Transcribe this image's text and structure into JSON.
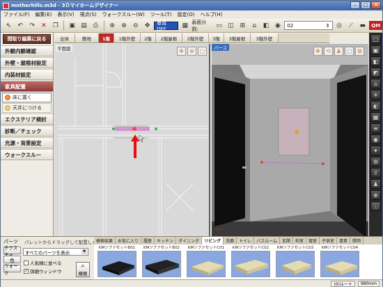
{
  "window": {
    "title": "motherhills.m3d - 3Ｄマイホームデザイナー"
  },
  "menu": [
    "ファイル(F)",
    "編集(E)",
    "表示(V)",
    "視点(S)",
    "ウォークスルー(W)",
    "ツール(T)",
    "設定(O)",
    "ヘルプ(H)"
  ],
  "toolbar": {
    "ortho_label": "垂直OFF",
    "grid_label": "画面分割:",
    "view_select": "02",
    "qm_label": "QM"
  },
  "left_panel": {
    "back_label": "間取り編集に戻る",
    "items": [
      "外観内観確認",
      "外壁・屋根材設定",
      "内装材設定",
      "家具配置"
    ],
    "sub_items": [
      "床に置く",
      "天井につける"
    ],
    "more_items": [
      "エクステリア検討",
      "診断／チェック",
      "光源・背景設定",
      "ウォークスルー"
    ]
  },
  "floor_tabs": [
    "全体",
    "敷地",
    "1階",
    "1階外壁",
    "2階",
    "2階屋根",
    "2階外壁",
    "3階",
    "3階屋根",
    "3階外壁"
  ],
  "selected_floor_tab": "1階",
  "plan_view": {
    "label": "平面図"
  },
  "three_view": {
    "label": "パース"
  },
  "parts_panel": {
    "label": "パーツ",
    "help": "パレットからドラッグして配置します。",
    "select_value": "すべてのパーツを表示",
    "side_buttons": [
      "テクスチャ",
      "色",
      "ウォーク"
    ],
    "check_popular": "人気順に並べる",
    "check_detail": "詳細ウィンドウ",
    "search_label": "検索"
  },
  "category_tabs": [
    "検索結果",
    "お気に入り",
    "履歴",
    "キッチン",
    "ダイニング",
    "リビング",
    "洗面",
    "トイレ",
    "バスルーム",
    "玄関",
    "和室",
    "寝室",
    "子供室",
    "書斎",
    "照明"
  ],
  "selected_category": "リビング",
  "catalog_items": [
    {
      "name": "KMソファセットB01",
      "color": "#1a1a1a"
    },
    {
      "name": "KMソファセットB02",
      "color": "#222222"
    },
    {
      "name": "KMソファセットC01",
      "color": "#d8cfa0"
    },
    {
      "name": "KMソファセットC02",
      "color": "#d8cfa0"
    },
    {
      "name": "KMソファセットC03",
      "color": "#d8cfa0"
    },
    {
      "name": "KMソファセットC04",
      "color": "#d8cfa0"
    }
  ],
  "status": {
    "left": "(0)ルート",
    "right": "980mm"
  },
  "colors": {
    "accent": "#c02626",
    "plan_bg": "#d9d9d9",
    "wall_door": "#0e0e0e",
    "arrow": "#e01010"
  }
}
